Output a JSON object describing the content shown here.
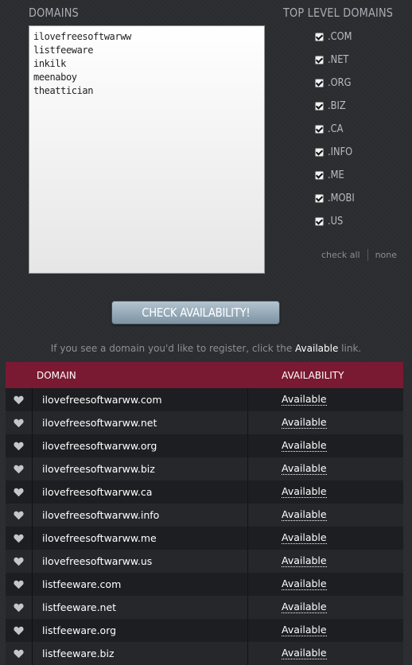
{
  "domains_section": {
    "title": "DOMAINS",
    "entries": [
      "ilovefreesoftwarww",
      "listfeeware",
      "inkilk",
      "meenaboy",
      "theattician"
    ]
  },
  "tld_section": {
    "title": "TOP LEVEL DOMAINS",
    "items": [
      {
        "label": ".COM",
        "checked": true
      },
      {
        "label": ".NET",
        "checked": true
      },
      {
        "label": ".ORG",
        "checked": true
      },
      {
        "label": ".BIZ",
        "checked": true
      },
      {
        "label": ".CA",
        "checked": true
      },
      {
        "label": ".INFO",
        "checked": true
      },
      {
        "label": ".ME",
        "checked": true
      },
      {
        "label": ".MOBI",
        "checked": true
      },
      {
        "label": ".US",
        "checked": true
      }
    ],
    "check_all": "check all",
    "none": "none"
  },
  "check_button": "CHECK AVAILABILITY!",
  "hint": {
    "before": "If you see a domain you'd like to register, click the ",
    "link": "Available",
    "after": " link."
  },
  "results": {
    "headers": {
      "domain": "DOMAIN",
      "availability": "AVAILABILITY"
    },
    "rows": [
      {
        "domain": "ilovefreesoftwarww.com",
        "status": "Available"
      },
      {
        "domain": "ilovefreesoftwarww.net",
        "status": "Available"
      },
      {
        "domain": "ilovefreesoftwarww.org",
        "status": "Available"
      },
      {
        "domain": "ilovefreesoftwarww.biz",
        "status": "Available"
      },
      {
        "domain": "ilovefreesoftwarww.ca",
        "status": "Available"
      },
      {
        "domain": "ilovefreesoftwarww.info",
        "status": "Available"
      },
      {
        "domain": "ilovefreesoftwarww.me",
        "status": "Available"
      },
      {
        "domain": "ilovefreesoftwarww.us",
        "status": "Available"
      },
      {
        "domain": "listfeeware.com",
        "status": "Available"
      },
      {
        "domain": "listfeeware.net",
        "status": "Available"
      },
      {
        "domain": "listfeeware.org",
        "status": "Available"
      },
      {
        "domain": "listfeeware.biz",
        "status": "Available"
      }
    ]
  },
  "colors": {
    "background": "#2b2d31",
    "header_bar": "#7a1a32",
    "button_top": "#b4c4d0",
    "button_bottom": "#7c93a3"
  }
}
